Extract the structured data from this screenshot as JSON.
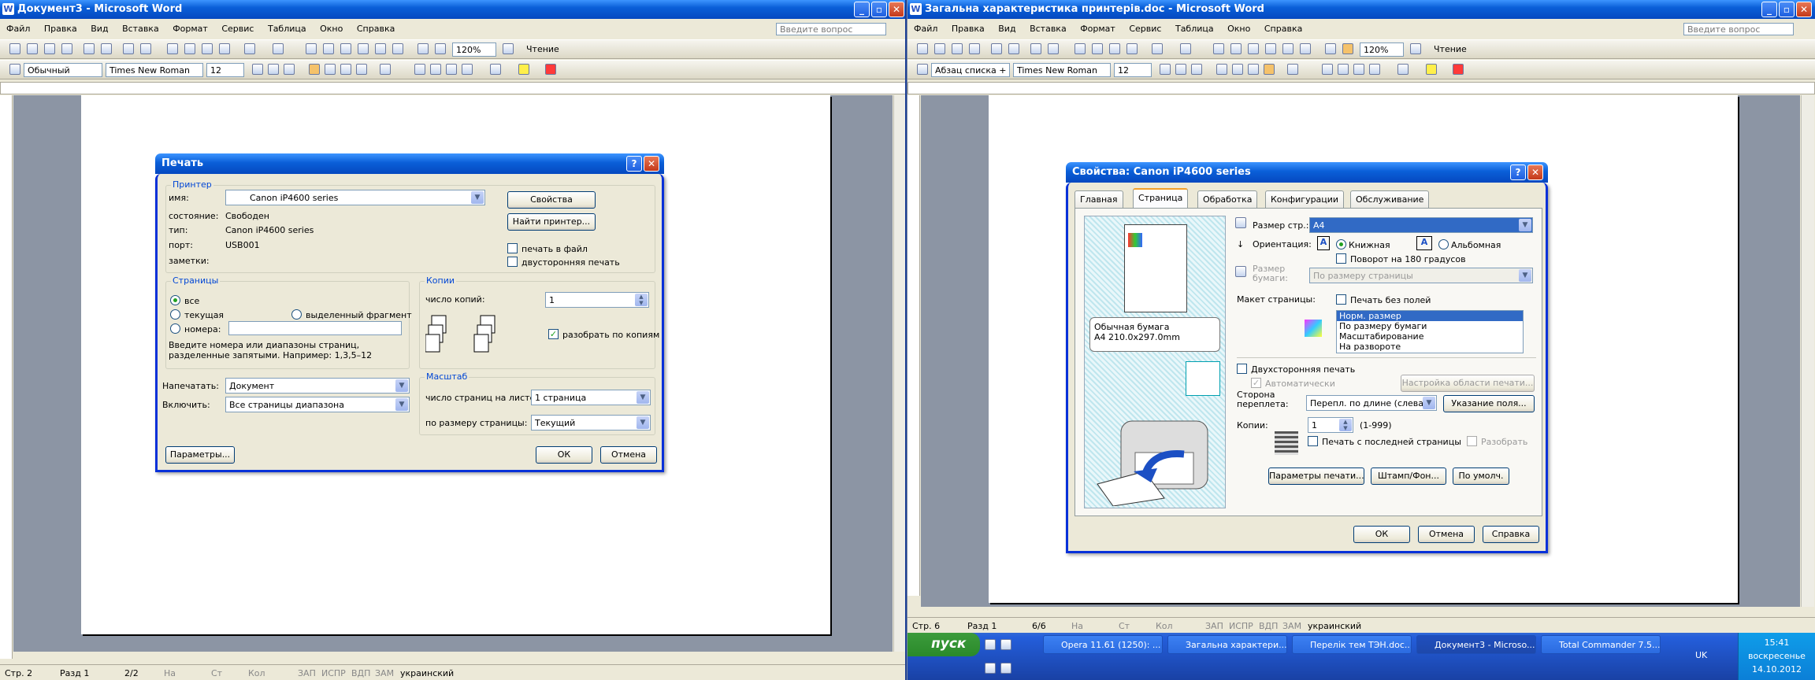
{
  "left": {
    "title": "Документ3 - Microsoft Word",
    "menus": [
      "Файл",
      "Правка",
      "Вид",
      "Вставка",
      "Формат",
      "Сервис",
      "Таблица",
      "Окно",
      "Справка"
    ],
    "ask": "Введите вопрос",
    "zoom": "120%",
    "read": "Чтение",
    "style": "Обычный",
    "font": "Times New Roman",
    "size": "12",
    "status": {
      "page": "Стр. 2",
      "section": "Разд 1",
      "pages": "2/2",
      "at": "На",
      "ln": "Ст",
      "col": "Кол",
      "rec": "ЗАП",
      "trk": "ИСПР",
      "ext": "ВДП",
      "ovr": "ЗАМ",
      "lang": "украинский"
    }
  },
  "right": {
    "title": "Загальна характеристика принтерів.doc - Microsoft Word",
    "ask": "Введите вопрос",
    "zoom": "120%",
    "read": "Чтение",
    "style": "Абзац списка +",
    "font": "Times New Roman",
    "size": "12",
    "status": {
      "page": "Стр. 6",
      "section": "Разд 1",
      "pages": "6/6",
      "at": "На",
      "ln": "Ст",
      "col": "Кол",
      "rec": "ЗАП",
      "trk": "ИСПР",
      "ext": "ВДП",
      "ovr": "ЗАМ",
      "lang": "украинский"
    }
  },
  "print": {
    "title": "Печать",
    "printer_group": "Принтер",
    "name_label": "имя:",
    "name": "Canon iP4600 series",
    "state_label": "состояние:",
    "state": "Свободен",
    "type_label": "тип:",
    "type": "Canon iP4600 series",
    "port_label": "порт:",
    "port": "USB001",
    "notes_label": "заметки:",
    "properties_btn": "Свойства",
    "find_btn": "Найти принтер...",
    "to_file": "печать в файл",
    "duplex": "двусторонняя печать",
    "pages_group": "Страницы",
    "all": "все",
    "current": "текущая",
    "selection": "выделенный фрагмент",
    "numbers": "номера:",
    "hint": "Введите номера или диапазоны страниц, разделенные запятыми. Например: 1,3,5–12",
    "copies_group": "Копии",
    "copies_label": "число копий:",
    "copies": "1",
    "collate": "разобрать по копиям",
    "print_what_label": "Напечатать:",
    "print_what": "Документ",
    "include_label": "Включить:",
    "include": "Все страницы диапазона",
    "scale_group": "Масштаб",
    "per_sheet_label": "число страниц на листе:",
    "per_sheet": "1 страница",
    "fit_label": "по размеру страницы:",
    "fit": "Текущий",
    "options_btn": "Параметры...",
    "ok": "ОК",
    "cancel": "Отмена"
  },
  "props": {
    "title": "Свойства: Canon iP4600 series",
    "tabs": [
      "Главная",
      "Страница",
      "Обработка",
      "Конфигурации",
      "Обслуживание"
    ],
    "page_size_label": "Размер стр.:",
    "page_size": "A4",
    "orientation_label": "Ориентация:",
    "portrait": "Книжная",
    "landscape": "Альбомная",
    "rotate": "Поворот на 180 градусов",
    "paper_size_label": "Размер бумаги:",
    "paper_size": "По размеру страницы",
    "layout_label": "Макет страницы:",
    "borderless": "Печать без полей",
    "layouts": [
      "Норм. размер",
      "По размеру бумаги",
      "Масштабирование",
      "На развороте"
    ],
    "paper_info_1": "Обычная бумага",
    "paper_info_2": "A4 210.0x297.0mm",
    "duplex": "Двухсторонняя печать",
    "auto": "Автоматически",
    "area_btn": "Настройка области печати...",
    "binding_label": "Сторона переплета:",
    "binding": "Перепл. по длине (слева)",
    "margin_btn": "Указание поля...",
    "copies_label": "Копии:",
    "copies": "1",
    "copies_range": "(1-999)",
    "reverse": "Печать с последней страницы",
    "collate": "Разобрать",
    "params_btn": "Параметры печати...",
    "stamp_btn": "Штамп/Фон...",
    "default_btn": "По умолч.",
    "ok": "ОК",
    "cancel": "Отмена",
    "help": "Справка"
  },
  "taskbar": {
    "start": "пуск",
    "tasks": [
      "Opera 11.61 (1250): ...",
      "Загальна характери...",
      "Перелік тем ТЭН.doc...",
      "Документ3 - Microso...",
      "Total Commander 7.5..."
    ],
    "lang": "UK",
    "time": "15:41",
    "day": "воскресенье",
    "date": "14.10.2012"
  }
}
